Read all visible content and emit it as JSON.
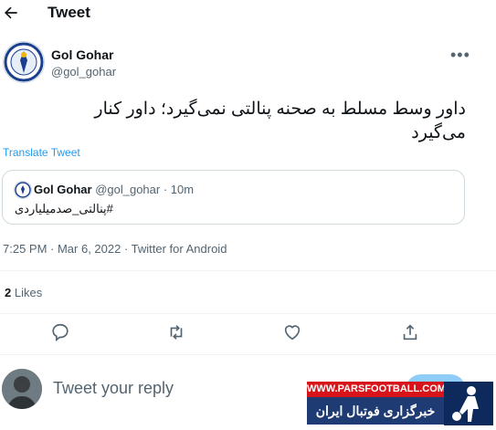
{
  "header": {
    "title": "Tweet"
  },
  "tweet": {
    "author_name": "Gol Gohar",
    "author_handle": "@gol_gohar",
    "text_line1": "داور وسط مسلط به صحنه پنالتی نمی‌گیرد؛ داور کنار",
    "text_line2": "می‌گیرد",
    "translate_label": "Translate Tweet",
    "meta": "7:25 PM · Mar 6, 2022 · Twitter for Android",
    "likes_count": "2",
    "likes_label": "Likes"
  },
  "quote": {
    "author_name": "Gol Gohar",
    "author_handle": "@gol_gohar · 10m",
    "text": "#پنالتی_صدمیلیاردی"
  },
  "reply": {
    "placeholder": "Tweet your reply"
  },
  "ad": {
    "site": "WWW.PARSFOOTBALL.COM",
    "tagline": "خبرگزاری فوتبال ایران"
  },
  "icons": [
    "back-arrow-icon",
    "more-icon",
    "reply-icon",
    "retweet-icon",
    "like-icon",
    "share-icon"
  ]
}
